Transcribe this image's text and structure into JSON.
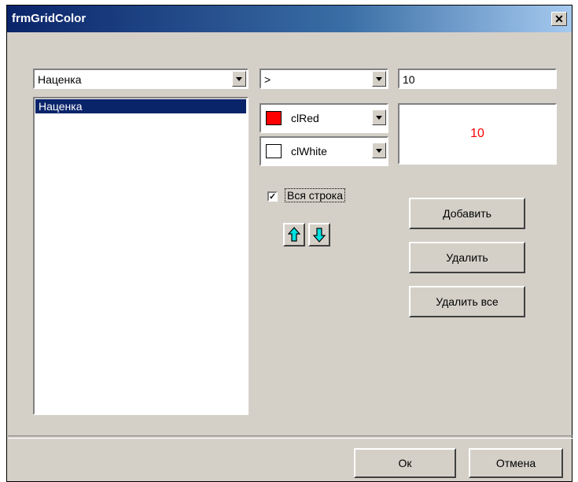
{
  "window": {
    "title": "frmGridColor",
    "close_glyph": "✕"
  },
  "field_combo": {
    "value": "Наценка"
  },
  "field_list": {
    "items": [
      "Наценка"
    ]
  },
  "operator_combo": {
    "value": ">"
  },
  "value_input": {
    "value": "10"
  },
  "font_color_combo": {
    "value": "clRed",
    "swatch_color": "#ff0000"
  },
  "back_color_combo": {
    "value": "clWhite",
    "swatch_color": "#ffffff"
  },
  "preview": {
    "text": "10",
    "text_color": "#ff0000",
    "background": "#ffffff"
  },
  "whole_row_checkbox": {
    "label": "Вся строка",
    "checked": true,
    "check_glyph": "✓"
  },
  "move_buttons": {
    "up_icon": "arrow-up-icon",
    "down_icon": "arrow-down-icon"
  },
  "buttons": {
    "add": "Добавить",
    "delete": "Удалить",
    "delete_all": "Удалить все",
    "ok": "Ок",
    "cancel": "Отмена"
  }
}
